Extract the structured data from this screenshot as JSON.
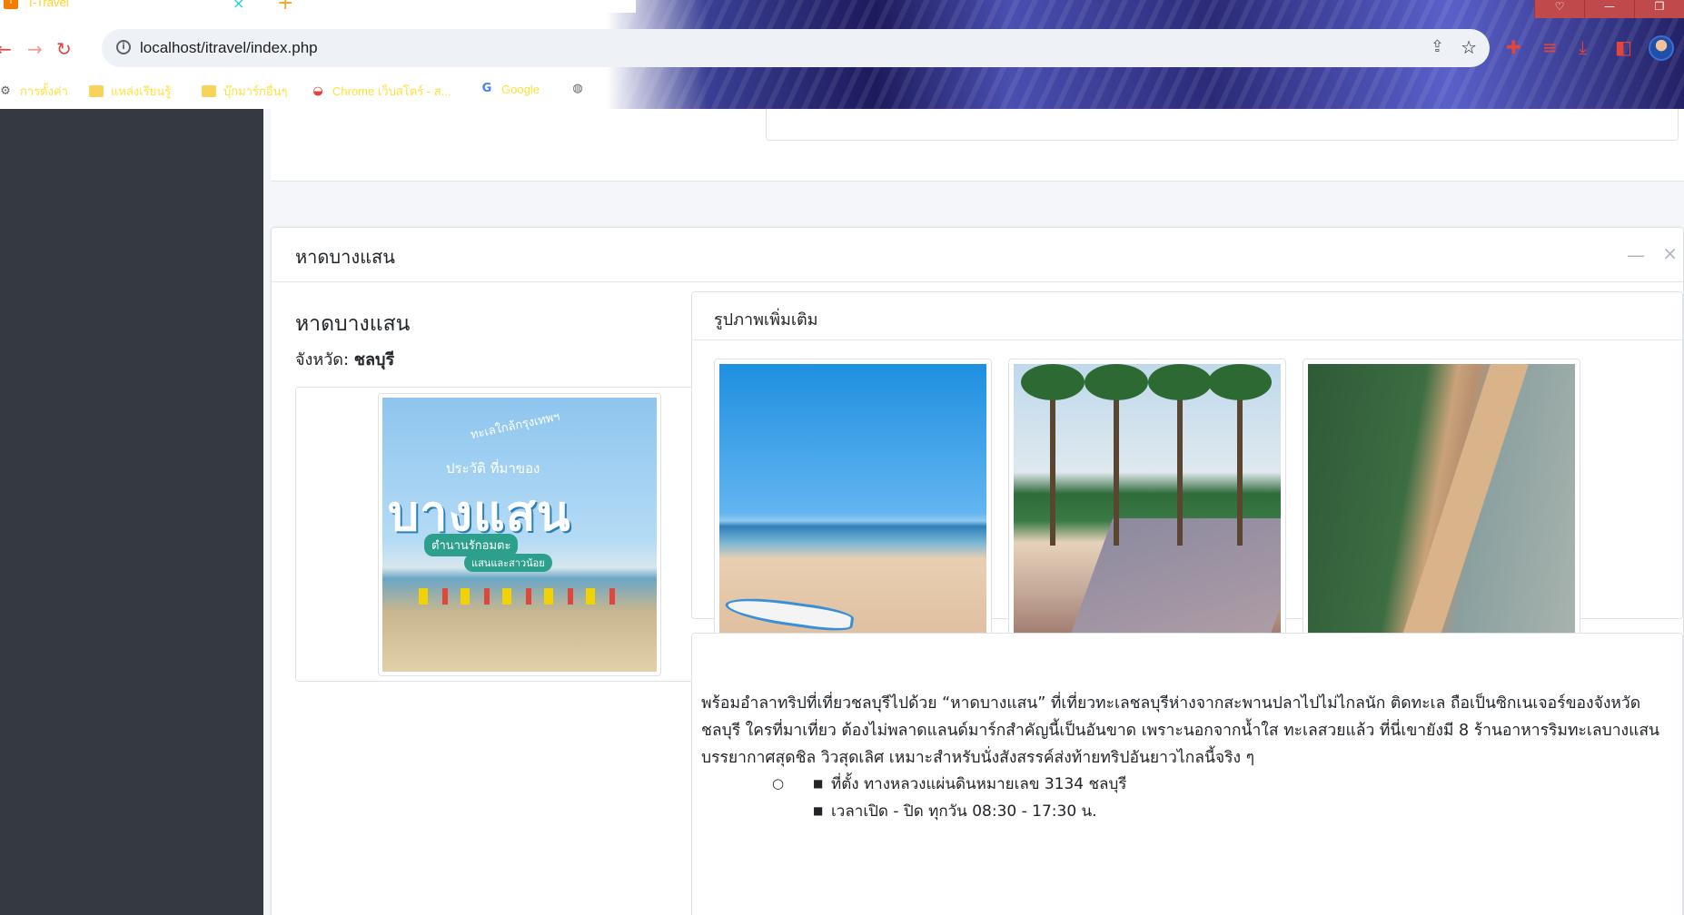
{
  "browser": {
    "tab_title": "I-Travel",
    "tab_close": "×",
    "new_tab": "+",
    "url": "localhost/itravel/index.php",
    "window_controls": [
      "♡",
      "—",
      "❐"
    ],
    "bookmarks": [
      {
        "label": "การตั้งค่า",
        "icon": "gear-icon"
      },
      {
        "label": "แหล่งเรียนรู้",
        "icon": "folder-icon"
      },
      {
        "label": "บุ๊กมาร์กอื่นๆ",
        "icon": "folder-icon"
      },
      {
        "label": "Chrome เว็บสโตร์ - ส...",
        "icon": "chrome-webstore-icon"
      },
      {
        "label": "Google",
        "icon": "google-icon"
      },
      {
        "label": "",
        "icon": "globe-icon"
      }
    ]
  },
  "card": {
    "header_title": "หาดบางแสน",
    "minimize_symbol": "—",
    "close_symbol": "×"
  },
  "place": {
    "name": "หาดบางแสน",
    "province_label": "จังหวัด: ",
    "province_value": "ชลบุรี",
    "cover_text": {
      "line1": "ทะเลใกล้กรุงเทพฯ",
      "line2": "ประวัติ ที่มาของ",
      "line3": "บางแสน",
      "line4": "ตำนานรักอมตะ",
      "line5": "แสนและสาวน้อย"
    }
  },
  "gallery": {
    "title": "รูปภาพเพิ่มเติม",
    "images": [
      "beach-with-paddleboard",
      "palm-tree-promenade",
      "aerial-coastline"
    ]
  },
  "description": {
    "paragraph": "พร้อมอำลาทริปที่เที่ยวชลบุรีไปด้วย “หาดบางแสน” ที่เที่ยวทะเลชลบุรีห่างจากสะพานปลาไปไม่ไกลนัก ติดทะเล ถือเป็นซิกเนเจอร์ของจังหวัดชลบุรี ใครที่มาเที่ยว ต้องไม่พลาดแลนด์มาร์กสำคัญนี้เป็นอันขาด เพราะนอกจากน้ำใส ทะเลสวยแล้ว ที่นี่เขายังมี 8 ร้านอาหารริมทะเลบางแสน บรรยากาศสุดชิล วิวสุดเลิศ เหมาะสำหรับนั่งสังสรรค์ส่งท้ายทริปอันยาวไกลนี้จริง ๆ",
    "items": [
      {
        "text": "ที่ตั้ง ทางหลวงแผ่นดินหมายเลข 3134 ชลบุรี"
      },
      {
        "text": "เวลาเปิด - ปิด ทุกวัน 08:30 - 17:30 น."
      }
    ]
  },
  "colors": {
    "sidebar": "#343a40",
    "content_bg": "#f4f6f9",
    "bookmark_text": "#ffe03a",
    "nav_icon": "#e2453c",
    "window_controls": "#c0494b"
  }
}
